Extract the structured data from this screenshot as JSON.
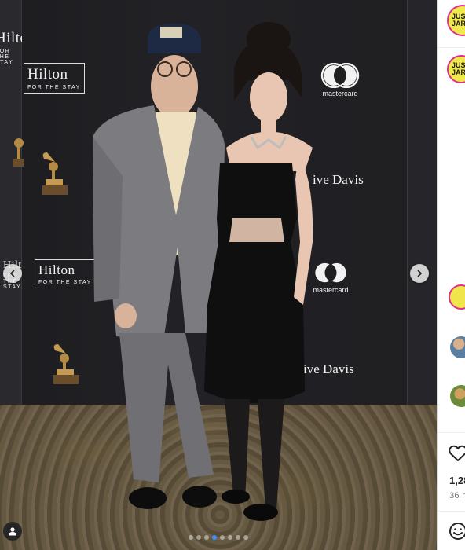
{
  "post": {
    "sponsors": {
      "hilton_name": "Hilton",
      "hilton_tagline": "FOR THE STAY",
      "mastercard_label": "mastercard",
      "davis_text": "ive Davis"
    },
    "carousel": {
      "slide_count": 8,
      "active_index": 3
    }
  },
  "sidebar": {
    "account_avatar_text": "JUST JARED",
    "post_avatar_text": "JUST JARED",
    "likes": "1,28",
    "time": "36 m"
  },
  "colors": {
    "accent": "#3a90ff",
    "avatar_bg": "#f1e94b",
    "story_ring": "#e02e8d"
  },
  "icons": [
    "chevron-left-icon",
    "chevron-right-icon",
    "user-tag-icon",
    "heart-icon",
    "emoji-icon",
    "grammy-icon",
    "mastercard-logo"
  ]
}
